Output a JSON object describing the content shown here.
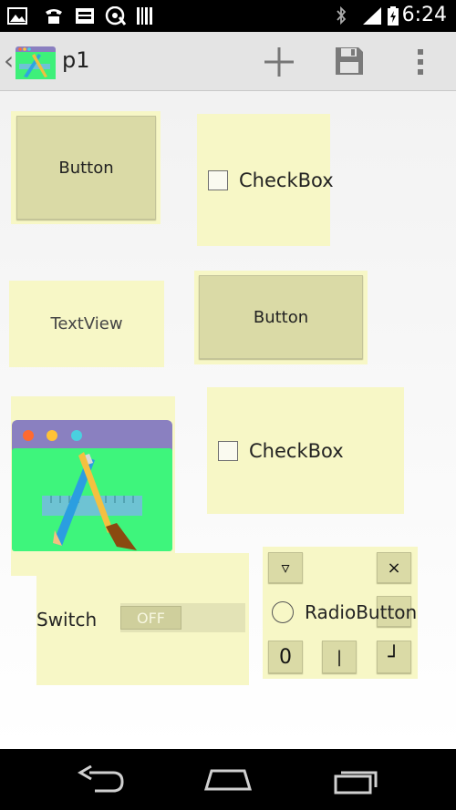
{
  "status_bar": {
    "time": "6:24",
    "left_icons": [
      "image-icon",
      "phone-icon",
      "screen-icon",
      "at-icon",
      "barcode-icon"
    ],
    "right_icons": [
      "bluetooth-icon",
      "signal-icon",
      "battery-icon"
    ]
  },
  "action_bar": {
    "title": "p1",
    "back_glyph": "‹",
    "actions": [
      "add-icon",
      "save-icon",
      "overflow-menu-icon"
    ]
  },
  "canvas": {
    "button_1": "Button",
    "checkbox_1": "CheckBox",
    "textview": "TextView",
    "button_2": "Button",
    "checkbox_2": "CheckBox",
    "image_icon": "app-design-icon",
    "switch": {
      "label": "Switch",
      "state": "OFF"
    },
    "radio_group": {
      "radio_label": "RadioButton",
      "keys": [
        "▿",
        "×",
        "0",
        "|",
        "┘"
      ]
    }
  },
  "colors": {
    "widget_bg": "#f7f7c6",
    "button_bg": "#dadaa6",
    "status_bar": "#000000",
    "action_bar": "#e4e4e4"
  }
}
